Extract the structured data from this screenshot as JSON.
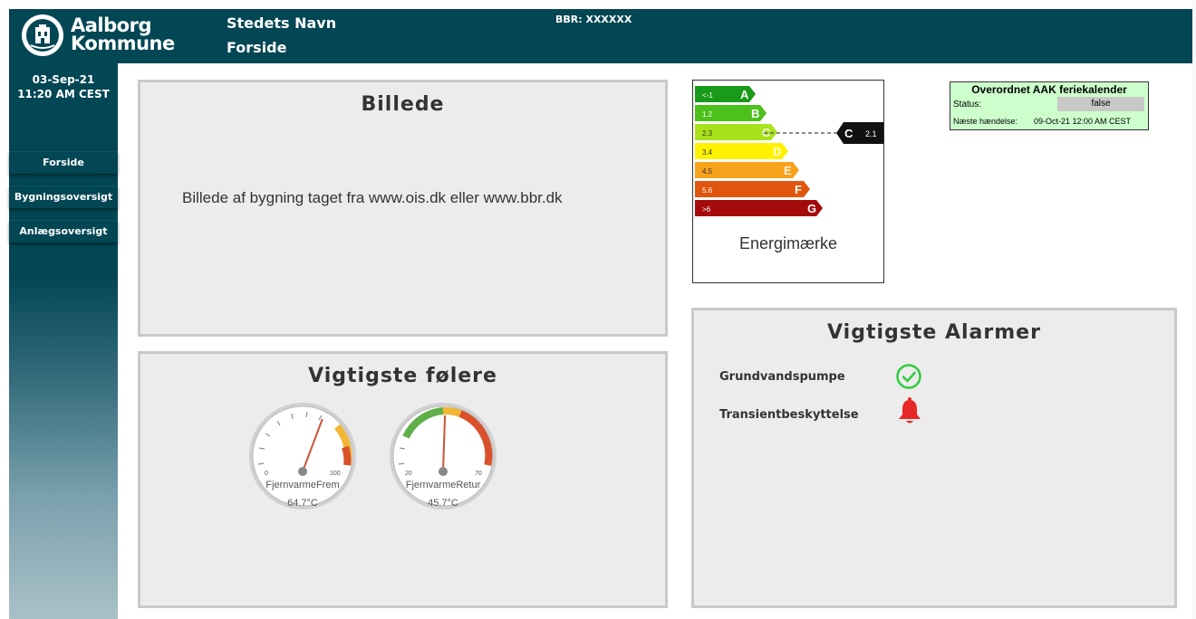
{
  "header": {
    "logo_line1": "Aalborg",
    "logo_line2": "Kommune",
    "site_name": "Stedets Navn",
    "page": "Forside",
    "bbr": "BBR: XXXXXX"
  },
  "sidebar": {
    "date": "03-Sep-21",
    "time": "11:20 AM CEST",
    "items": [
      {
        "label": "Forside"
      },
      {
        "label": "Bygningsoversigt"
      },
      {
        "label": "Anlægsoversigt"
      }
    ]
  },
  "billede": {
    "title": "Billede",
    "text": "Billede af bygning taget fra www.ois.dk eller www.bbr.dk"
  },
  "sensors": {
    "title": "Vigtigste følere",
    "gauges": [
      {
        "name": "FjernvarmeFrem",
        "value_text": "64.7°C",
        "value": 64.7,
        "min": 0,
        "max": 100,
        "min_label": "0",
        "max_label": "100"
      },
      {
        "name": "FjernvarmeRetur",
        "value_text": "45.7°C",
        "value": 45.7,
        "min": 20,
        "max": 70,
        "min_label": "20",
        "max_label": "70"
      }
    ]
  },
  "energy_label": {
    "caption": "Energimærke",
    "rows": [
      {
        "range": "<-1",
        "letter": "A",
        "color": "#1a9a1a"
      },
      {
        "range": "1.2",
        "letter": "B",
        "color": "#4cc11c"
      },
      {
        "range": "2.3",
        "letter": "C",
        "color": "#a8e21a"
      },
      {
        "range": "3.4",
        "letter": "D",
        "color": "#fff200"
      },
      {
        "range": "4.5",
        "letter": "E",
        "color": "#f7a21b"
      },
      {
        "range": "5.6",
        "letter": "F",
        "color": "#e1560e"
      },
      {
        "range": ">6",
        "letter": "G",
        "color": "#a50a0a"
      }
    ],
    "current_letter": "C",
    "current_value": "2.1"
  },
  "feriekalender": {
    "title": "Overordnet AAK feriekalender",
    "status_label": "Status:",
    "status_value": "false",
    "next_label": "Næste hændelse:",
    "next_value": "09-Oct-21 12:00 AM CEST"
  },
  "alarms": {
    "title": "Vigtigste Alarmer",
    "items": [
      {
        "label": "Grundvandspumpe",
        "icon": "check-circle-icon",
        "color": "#2ecc40"
      },
      {
        "label": "Transientbeskyttelse",
        "icon": "bell-icon",
        "color": "#e82727"
      }
    ]
  }
}
